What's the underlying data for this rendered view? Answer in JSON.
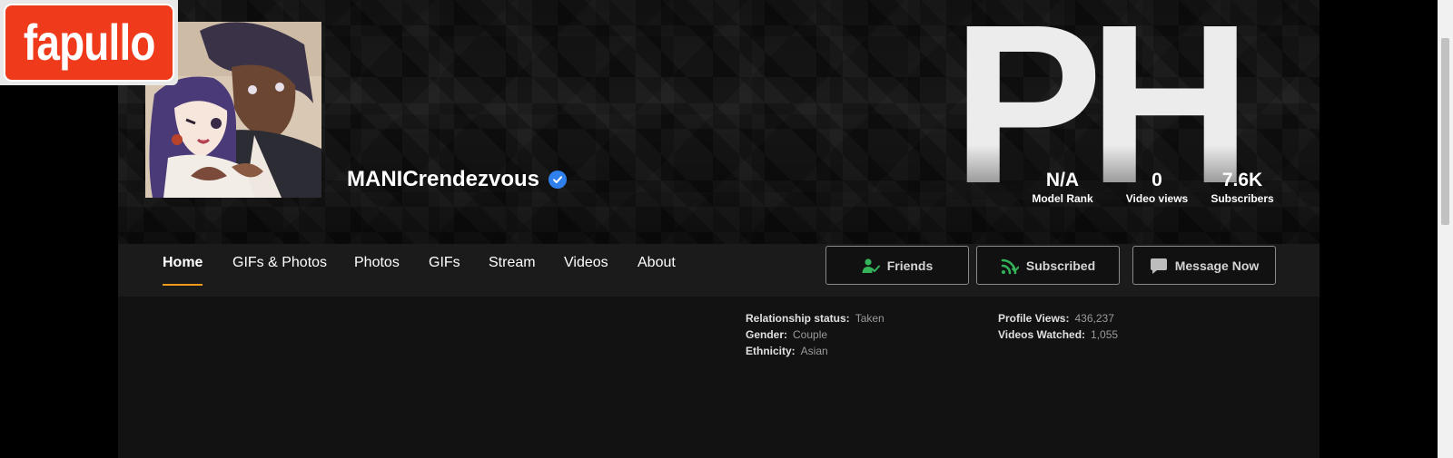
{
  "profile": {
    "name": "MANICrendezvous",
    "verified_color": "#2f80ed"
  },
  "cover_logo": {
    "letter1": "P",
    "letter2": "H"
  },
  "stats": [
    {
      "value": "N/A",
      "label": "Model Rank"
    },
    {
      "value": "0",
      "label": "Video views"
    },
    {
      "value": "7.6K",
      "label": "Subscribers"
    }
  ],
  "nav": {
    "tabs": [
      {
        "label": "Home",
        "active": true
      },
      {
        "label": "GIFs & Photos"
      },
      {
        "label": "Photos"
      },
      {
        "label": "GIFs"
      },
      {
        "label": "Stream"
      },
      {
        "label": "Videos"
      },
      {
        "label": "About"
      }
    ],
    "active_color": "#f19b1a"
  },
  "actions": {
    "friends_label": "Friends",
    "subscribed_label": "Subscribed",
    "message_label": "Message Now",
    "icon_green": "#35b35a",
    "icons": [
      "friend-check-icon",
      "rss-icon",
      "chat-bubble-icon"
    ]
  },
  "info": {
    "left": [
      {
        "key": "Relationship status:",
        "value": "Taken"
      },
      {
        "key": "Gender:",
        "value": "Couple"
      },
      {
        "key": "Ethnicity:",
        "value": "Asian"
      }
    ],
    "right": [
      {
        "key": "Profile Views:",
        "value": "436,237"
      },
      {
        "key": "Videos Watched:",
        "value": "1,055"
      }
    ]
  },
  "watermark": {
    "text": "fapullo",
    "color": "#ef3b1c"
  }
}
